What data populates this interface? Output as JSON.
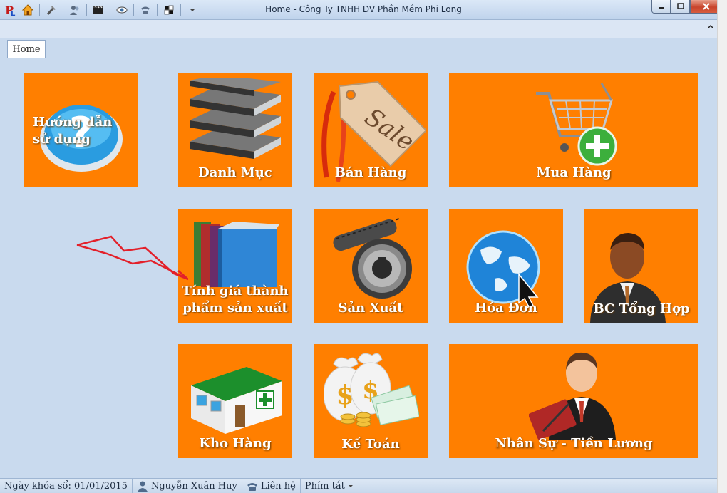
{
  "window": {
    "title": "Home - Công Ty TNHH DV Phần Mềm Phi Long"
  },
  "tabs": [
    {
      "label": "Home"
    }
  ],
  "tiles": {
    "guide": "Hướng dẫn sử dụng",
    "catalog": "Danh Mục",
    "sales": "Bán Hàng",
    "purchase": "Mua Hàng",
    "costing_line1": "Tính giá thành",
    "costing_line2": "phẩm sản xuất",
    "production": "Sản Xuất",
    "invoice": "Hóa Đơn",
    "report": "BC Tổng Hợp",
    "warehouse": "Kho Hàng",
    "accounting": "Kế Toán",
    "hr": "Nhân Sự - Tiền Lương"
  },
  "sale_tag_text": "Sale",
  "status": {
    "lock_date": "Ngày khóa sổ: 01/01/2015",
    "user": "Nguyễn Xuân Huy",
    "contact": "Liên hệ",
    "shortcuts": "Phím tắt"
  },
  "colors": {
    "tile": "#ff7f00",
    "background": "#c9daee",
    "arrow": "#e3202a"
  },
  "icons": {
    "qat": [
      "app-logo-icon",
      "home-icon",
      "tools-icon",
      "users-icon",
      "video-icon",
      "eye-icon",
      "phone-icon",
      "grid-icon",
      "dropdown-icon"
    ]
  }
}
